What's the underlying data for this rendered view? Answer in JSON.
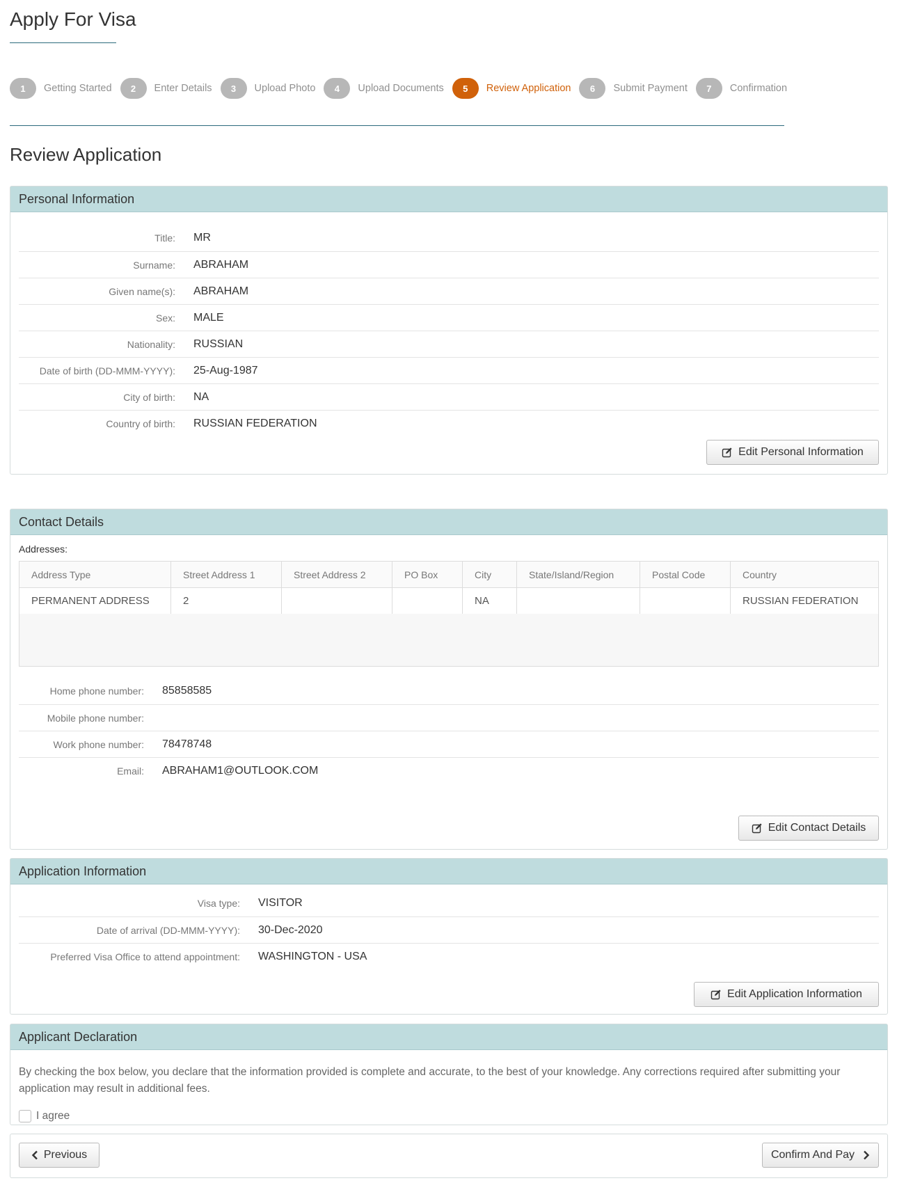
{
  "page": {
    "title": "Apply For Visa"
  },
  "stepper": {
    "steps": [
      {
        "num": "1",
        "label": "Getting Started"
      },
      {
        "num": "2",
        "label": "Enter Details"
      },
      {
        "num": "3",
        "label": "Upload Photo"
      },
      {
        "num": "4",
        "label": "Upload Documents"
      },
      {
        "num": "5",
        "label": "Review Application"
      },
      {
        "num": "6",
        "label": "Submit Payment"
      },
      {
        "num": "7",
        "label": "Confirmation"
      }
    ],
    "active_step": "5"
  },
  "section_title": "Review Application",
  "personal": {
    "heading": "Personal Information",
    "rows": [
      {
        "label": "Title:",
        "value": "MR"
      },
      {
        "label": "Surname:",
        "value": "ABRAHAM"
      },
      {
        "label": "Given name(s):",
        "value": "ABRAHAM"
      },
      {
        "label": "Sex:",
        "value": "MALE"
      },
      {
        "label": "Nationality:",
        "value": "RUSSIAN"
      },
      {
        "label": "Date of birth (DD-MMM-YYYY):",
        "value": "25-Aug-1987"
      },
      {
        "label": "City of birth:",
        "value": "NA"
      },
      {
        "label": "Country of birth:",
        "value": "RUSSIAN FEDERATION"
      }
    ],
    "edit_label": "Edit Personal Information"
  },
  "contact": {
    "heading": "Contact Details",
    "addresses_label": "Addresses:",
    "columns": [
      "Address Type",
      "Street Address 1",
      "Street Address 2",
      "PO Box",
      "City",
      "State/Island/Region",
      "Postal Code",
      "Country"
    ],
    "rows": [
      [
        "PERMANENT ADDRESS",
        "2",
        "",
        "",
        "NA",
        "",
        "",
        "RUSSIAN FEDERATION"
      ]
    ],
    "fields": [
      {
        "label": "Home phone number:",
        "value": "85858585"
      },
      {
        "label": "Mobile phone number:",
        "value": ""
      },
      {
        "label": "Work phone number:",
        "value": "78478748"
      },
      {
        "label": "Email:",
        "value": "ABRAHAM1@OUTLOOK.COM"
      }
    ],
    "edit_label": "Edit Contact Details"
  },
  "application": {
    "heading": "Application Information",
    "rows": [
      {
        "label": "Visa type:",
        "value": "VISITOR"
      },
      {
        "label": "Date of arrival (DD-MMM-YYYY):",
        "value": "30-Dec-2020"
      },
      {
        "label": "Preferred Visa Office to attend appointment:",
        "value": "WASHINGTON - USA"
      }
    ],
    "edit_label": "Edit Application Information"
  },
  "declaration": {
    "heading": "Applicant Declaration",
    "text": "By checking the box below, you declare that the information provided is complete and accurate, to the best of your knowledge. Any corrections required after submitting your application may result in additional fees.",
    "agree_label": "I agree",
    "agreed": false
  },
  "nav": {
    "previous_label": "Previous",
    "confirm_label": "Confirm And Pay"
  },
  "colors": {
    "accent": "#d0610a",
    "panel_heading": "#bfdcde",
    "rule": "#2b6a7c",
    "step_inactive": "#b7b7b7"
  },
  "icons": {
    "edit": "edit-icon",
    "previous": "chevron-left-icon",
    "next": "chevron-right-icon"
  }
}
